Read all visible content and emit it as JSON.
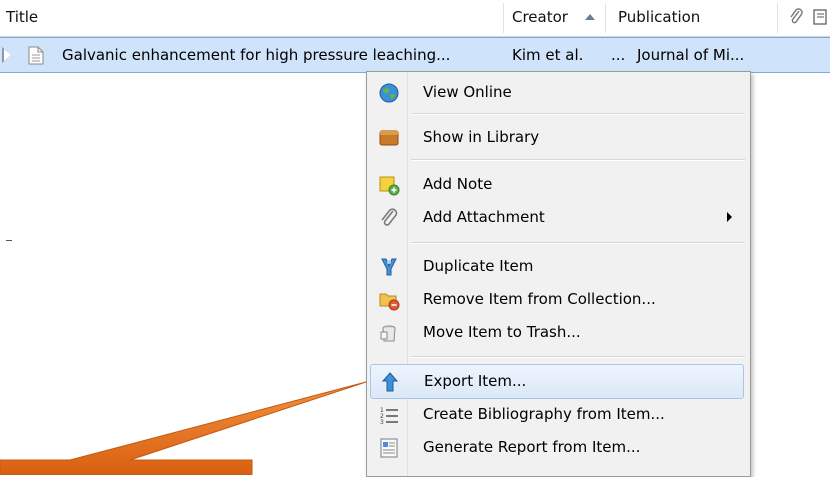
{
  "header": {
    "title": "Title",
    "creator": "Creator",
    "publication": "Publication"
  },
  "row": {
    "title": "Galvanic enhancement for high pressure leaching...",
    "creator": "Kim et al.",
    "ellipsis": "...",
    "publication": "Journal of Mi..."
  },
  "menu": {
    "view_online": "View Online",
    "show_in_library": "Show in Library",
    "add_note": "Add Note",
    "add_attachment": "Add Attachment",
    "duplicate_item": "Duplicate Item",
    "remove_item": "Remove Item from Collection...",
    "move_to_trash": "Move Item to Trash...",
    "export_item": "Export Item...",
    "create_bibliography": "Create Bibliography from Item...",
    "generate_report": "Generate Report from Item..."
  },
  "colors": {
    "selection": "#cfe3fb",
    "menu_bg": "#f1f1f1",
    "callout": "#e8731e",
    "highlight_border": "#a9c5e8"
  }
}
